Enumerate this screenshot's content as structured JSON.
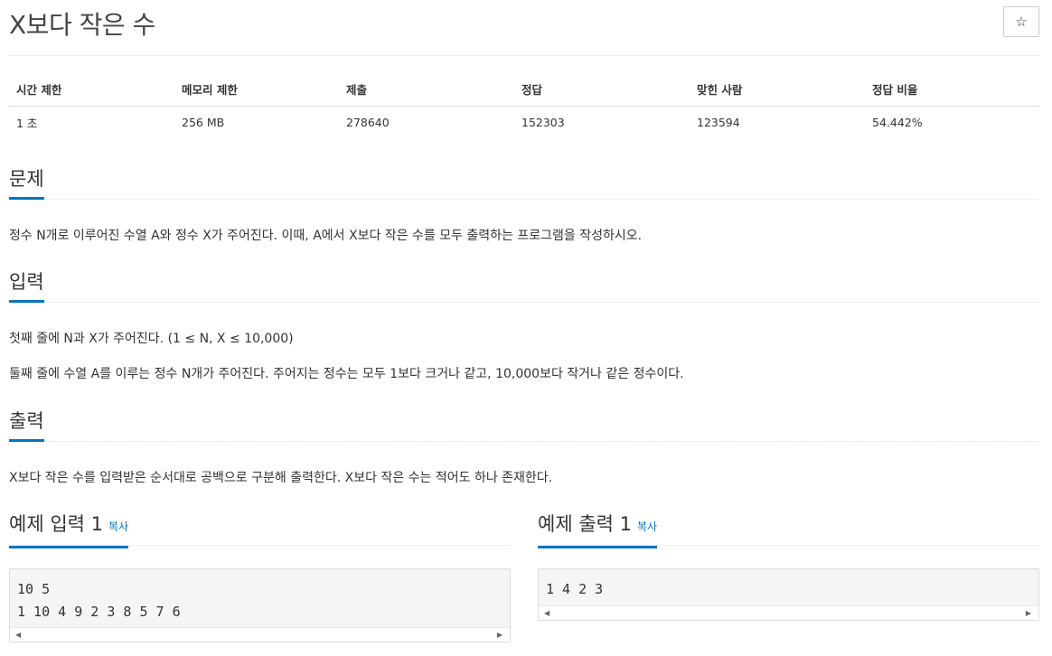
{
  "problem": {
    "title": "X보다 작은 수",
    "star_glyph": "☆"
  },
  "info": {
    "headers": [
      "시간 제한",
      "메모리 제한",
      "제출",
      "정답",
      "맞힌 사람",
      "정답 비율"
    ],
    "values": [
      "1 초",
      "256 MB",
      "278640",
      "152303",
      "123594",
      "54.442%"
    ]
  },
  "sections": {
    "description": {
      "title": "문제",
      "body": "정수 N개로 이루어진 수열 A와 정수 X가 주어진다. 이때, A에서 X보다 작은 수를 모두 출력하는 프로그램을 작성하시오."
    },
    "input": {
      "title": "입력",
      "line1": "첫째 줄에 N과 X가 주어진다. (1 ≤ N, X ≤ 10,000)",
      "line2": "둘째 줄에 수열 A를 이루는 정수 N개가 주어진다. 주어지는 정수는 모두 1보다 크거나 같고, 10,000보다 작거나 같은 정수이다."
    },
    "output": {
      "title": "출력",
      "body": "X보다 작은 수를 입력받은 순서대로 공백으로 구분해 출력한다. X보다 작은 수는 적어도 하나 존재한다."
    }
  },
  "samples": {
    "input": {
      "title": "예제 입력 1",
      "copy_label": "복사",
      "content": "10 5\n1 10 4 9 2 3 8 5 7 6"
    },
    "output": {
      "title": "예제 출력 1",
      "copy_label": "복사",
      "content": "1 4 2 3"
    }
  },
  "scroll": {
    "left_glyph": "◀",
    "right_glyph": "▶"
  }
}
